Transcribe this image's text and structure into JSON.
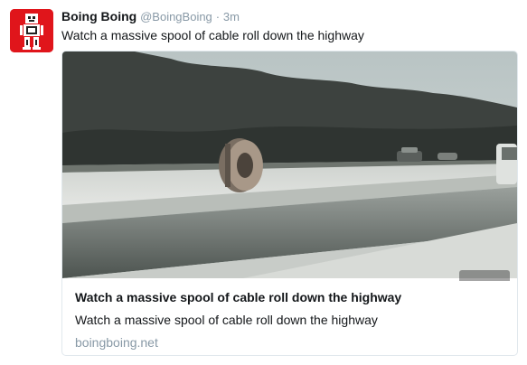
{
  "tweet": {
    "author_name": "Boing Boing",
    "handle": "@BoingBoing",
    "separator": "·",
    "time": "3m",
    "text": "Watch a massive spool of cable roll down the highway"
  },
  "card": {
    "title": "Watch a massive spool of cable roll down the highway",
    "description": "Watch a massive spool of cable roll down the highway",
    "domain": "boingboing.net"
  },
  "colors": {
    "avatar_bg": "#e0151b",
    "muted": "#8899a6",
    "text": "#14171a",
    "border": "#e1e8ed"
  },
  "icons": {
    "avatar": "robot-logo-icon",
    "media_badge": "gif-badge-icon"
  }
}
